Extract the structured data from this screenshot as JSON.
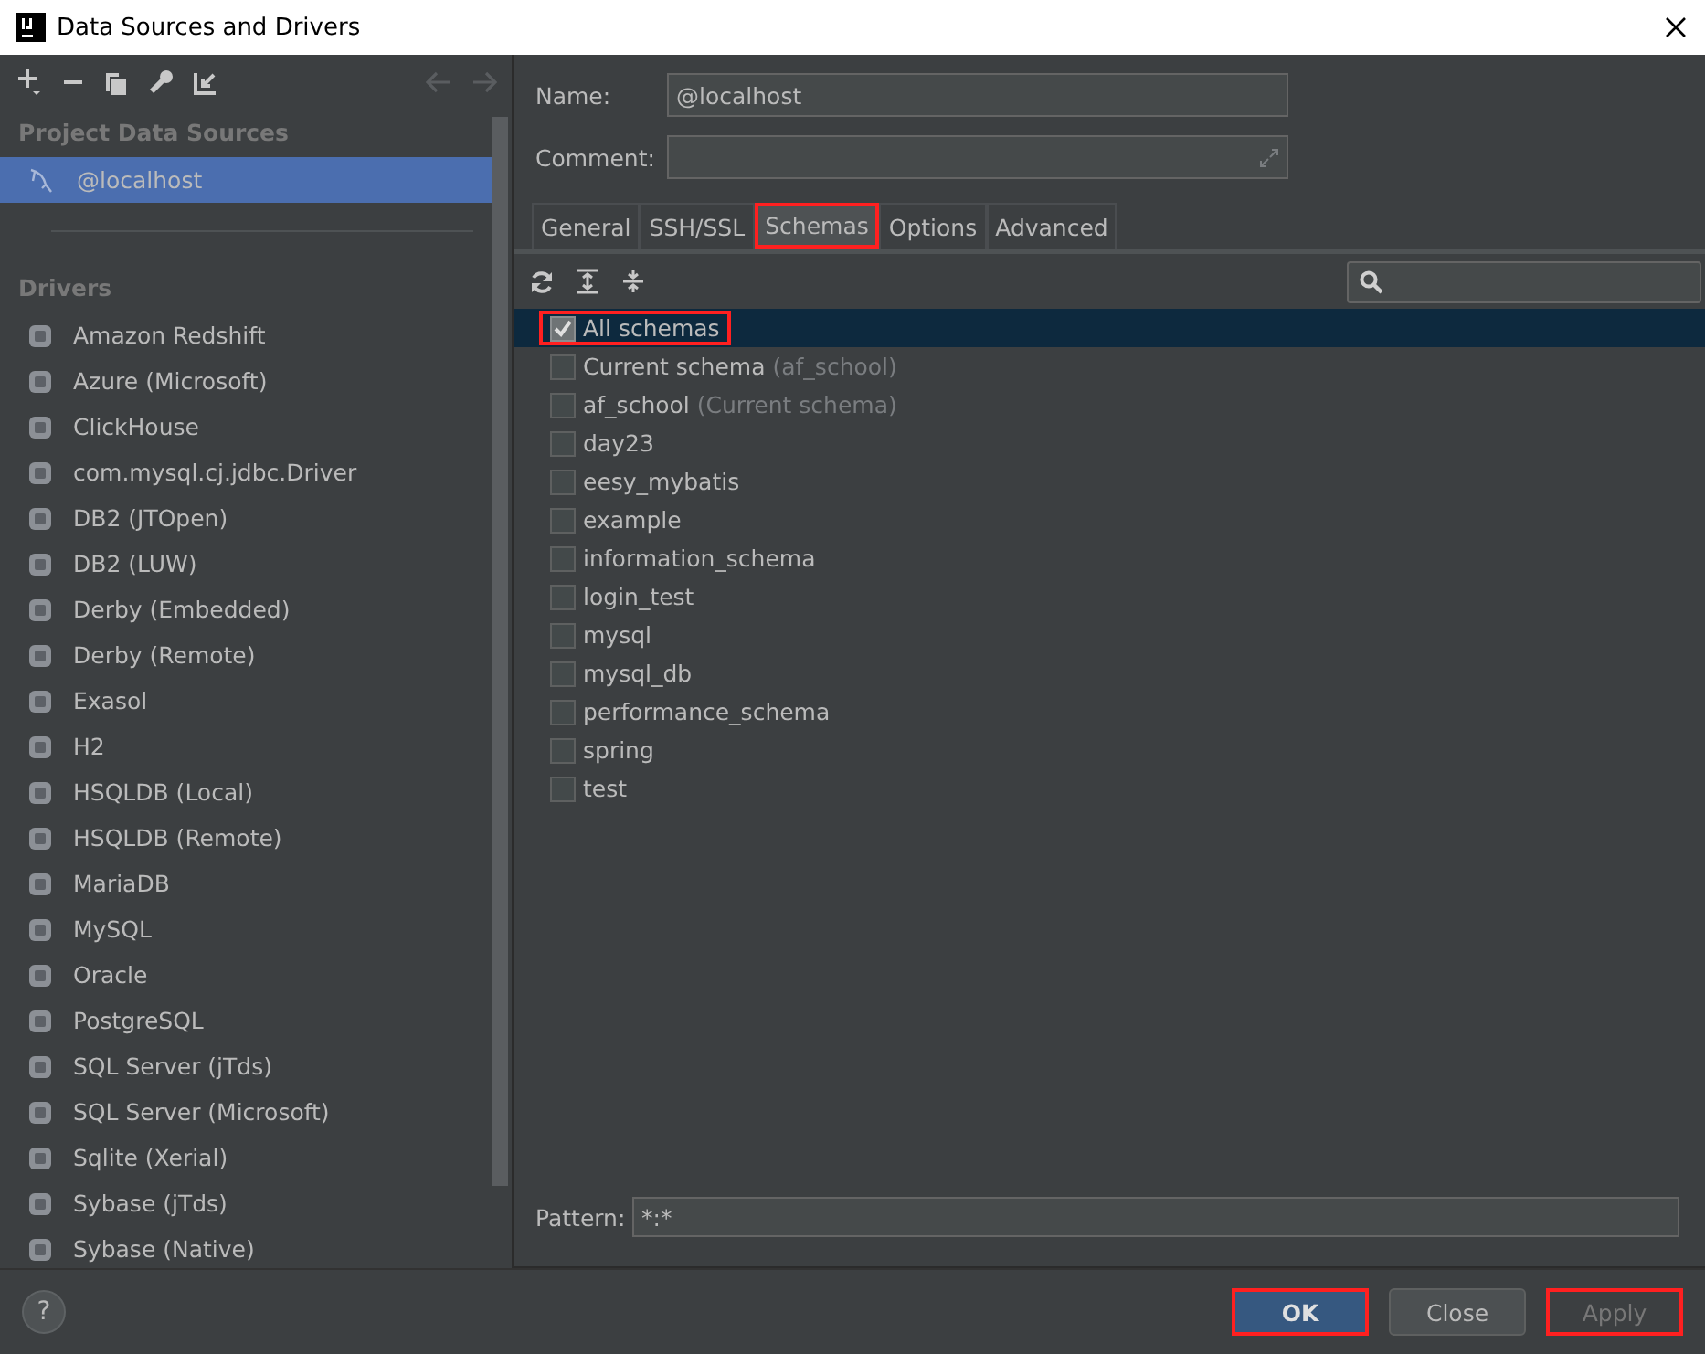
{
  "window": {
    "title": "Data Sources and Drivers"
  },
  "sidebar": {
    "sections": [
      {
        "title": "Project Data Sources",
        "items": [
          {
            "label": "@localhost",
            "selected": true
          }
        ]
      },
      {
        "title": "Drivers",
        "items": [
          {
            "label": "Amazon Redshift",
            "selected": false
          },
          {
            "label": "Azure (Microsoft)",
            "selected": false
          },
          {
            "label": "ClickHouse",
            "selected": false
          },
          {
            "label": "com.mysql.cj.jdbc.Driver",
            "selected": false
          },
          {
            "label": "DB2 (JTOpen)",
            "selected": false
          },
          {
            "label": "DB2 (LUW)",
            "selected": false
          },
          {
            "label": "Derby (Embedded)",
            "selected": false
          },
          {
            "label": "Derby (Remote)",
            "selected": false
          },
          {
            "label": "Exasol",
            "selected": false
          },
          {
            "label": "H2",
            "selected": false
          },
          {
            "label": "HSQLDB (Local)",
            "selected": false
          },
          {
            "label": "HSQLDB (Remote)",
            "selected": false
          },
          {
            "label": "MariaDB",
            "selected": false
          },
          {
            "label": "MySQL",
            "selected": false
          },
          {
            "label": "Oracle",
            "selected": false
          },
          {
            "label": "PostgreSQL",
            "selected": false
          },
          {
            "label": "SQL Server (jTds)",
            "selected": false
          },
          {
            "label": "SQL Server (Microsoft)",
            "selected": false
          },
          {
            "label": "Sqlite (Xerial)",
            "selected": false
          },
          {
            "label": "Sybase (jTds)",
            "selected": false
          },
          {
            "label": "Sybase (Native)",
            "selected": false
          }
        ]
      }
    ]
  },
  "form": {
    "name_label": "Name:",
    "name_value": "@localhost",
    "comment_label": "Comment:"
  },
  "tabs": [
    {
      "label": "General",
      "selected": false,
      "highlighted": false
    },
    {
      "label": "SSH/SSL",
      "selected": false,
      "highlighted": false
    },
    {
      "label": "Schemas",
      "selected": true,
      "highlighted": true
    },
    {
      "label": "Options",
      "selected": false,
      "highlighted": false
    },
    {
      "label": "Advanced",
      "selected": false,
      "highlighted": false
    }
  ],
  "schemas": [
    {
      "label": "All schemas",
      "checked": true,
      "selected": true,
      "highlighted": true
    },
    {
      "label": "Current schema",
      "note": "(af_school)",
      "checked": false,
      "selected": false,
      "highlighted": false
    },
    {
      "label": "af_school",
      "note": "(Current schema)",
      "checked": false,
      "selected": false,
      "highlighted": false
    },
    {
      "label": "day23",
      "checked": false,
      "selected": false,
      "highlighted": false
    },
    {
      "label": "eesy_mybatis",
      "checked": false,
      "selected": false,
      "highlighted": false
    },
    {
      "label": "example",
      "checked": false,
      "selected": false,
      "highlighted": false
    },
    {
      "label": "information_schema",
      "checked": false,
      "selected": false,
      "highlighted": false
    },
    {
      "label": "login_test",
      "checked": false,
      "selected": false,
      "highlighted": false
    },
    {
      "label": "mysql",
      "checked": false,
      "selected": false,
      "highlighted": false
    },
    {
      "label": "mysql_db",
      "checked": false,
      "selected": false,
      "highlighted": false
    },
    {
      "label": "performance_schema",
      "checked": false,
      "selected": false,
      "highlighted": false
    },
    {
      "label": "spring",
      "checked": false,
      "selected": false,
      "highlighted": false
    },
    {
      "label": "test",
      "checked": false,
      "selected": false,
      "highlighted": false
    }
  ],
  "pattern": {
    "label": "Pattern:",
    "value": "*:*"
  },
  "help": "?",
  "buttons": [
    {
      "label": "OK",
      "kind": "primary",
      "disabled": false,
      "highlighted": true
    },
    {
      "label": "Close",
      "kind": "normal",
      "disabled": false,
      "highlighted": false
    },
    {
      "label": "Apply",
      "kind": "normal",
      "disabled": true,
      "highlighted": true
    }
  ]
}
